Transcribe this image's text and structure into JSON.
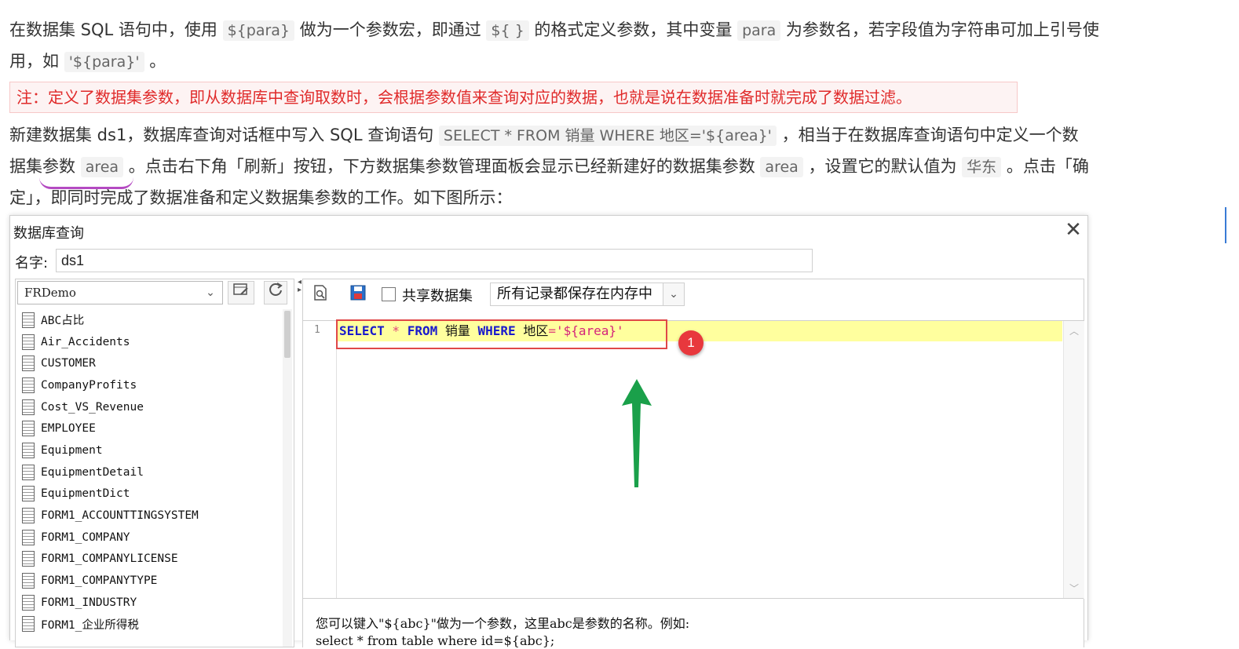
{
  "doc": {
    "para1": {
      "t1": "在数据集 SQL 语句中，使用 ",
      "c1": "${para}",
      "t2": " 做为一个参数宏，即通过 ",
      "c2": "${ }",
      "t3": " 的格式定义参数，其中变量 ",
      "c3": "para",
      "t4": " 为参数名，若字段值为字符串可加上引号使",
      "line2_t1": "用，如 ",
      "line2_c1": "'${para}'",
      "line2_t2": " 。"
    },
    "note": "注：定义了数据集参数，即从数据库中查询取数时，会根据参数值来查询对应的数据，也就是说在数据准备时就完成了数据过滤。",
    "para2": {
      "l1_t1": "新建数据集 ds1，数据库查询对话框中写入 SQL 查询语句 ",
      "l1_c1": "SELECT * FROM 销量 WHERE 地区='${area}'",
      "l1_t2": " ，相当于在数据库查询语句中定义一个数",
      "l2_t1": "据集参数 ",
      "l2_c1": "area",
      "l2_t2": " 。点击右下角「刷新」按钮，下方数据集参数管理面板会显示已经新建好的数据集参数 ",
      "l2_c2": "area",
      "l2_t3": " ，设置它的默认值为 ",
      "l2_c3": "华东",
      "l2_t4": " 。点击「确",
      "l3": "定」，即同时完成了数据准备和定义数据集参数的工作。如下图所示："
    }
  },
  "dialog": {
    "title": "数据库查询",
    "close_label": "✕",
    "name_label": "名字:",
    "name_value": "ds1",
    "database": "FRDemo",
    "tables": [
      "ABC占比",
      "Air_Accidents",
      "CUSTOMER",
      "CompanyProfits",
      "Cost_VS_Revenue",
      "EMPLOYEE",
      "Equipment",
      "EquipmentDetail",
      "EquipmentDict",
      "FORM1_ACCOUNTTINGSYSTEM",
      "FORM1_COMPANY",
      "FORM1_COMPANYLICENSE",
      "FORM1_COMPANYTYPE",
      "FORM1_INDUSTRY",
      "FORM1_企业所得税"
    ],
    "share_label": "共享数据集",
    "memory_option": "所有记录都保存在内存中",
    "line_number": "1",
    "sql": {
      "kw1": "SELECT",
      "op1": " * ",
      "kw2": "FROM",
      "tx1": " 销量 ",
      "kw3": "WHERE",
      "tx2": " 地区",
      "op2": "=",
      "str1": "'${area}'"
    },
    "badge": "1",
    "hint_line1": "您可以键入\"${abc}\"做为一个参数，这里abc是参数的名称。例如:",
    "hint_line2": "select * from table where id=${abc};"
  },
  "colors": {
    "note_text": "#e02a2a",
    "sql_keyword": "#1a1acc",
    "sql_string": "#d4237a",
    "highlight_box": "#e04848",
    "arrow": "#1aa04a",
    "badge": "#e8383d"
  }
}
